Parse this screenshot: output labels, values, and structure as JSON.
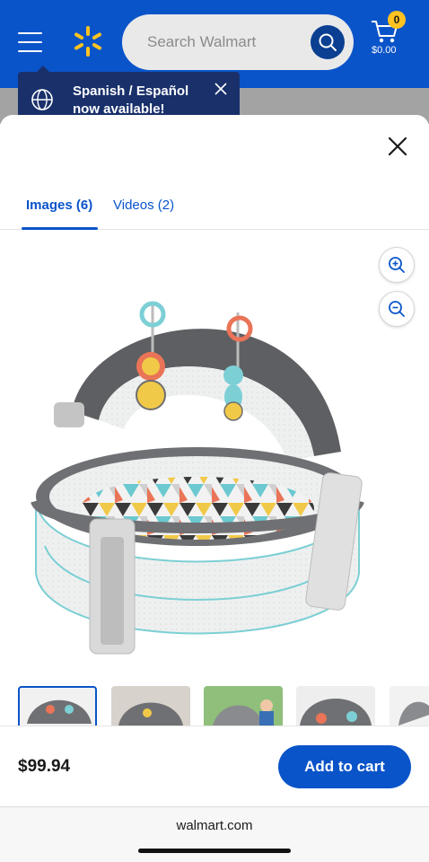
{
  "header": {
    "search_placeholder": "Search Walmart",
    "cart_count": "0",
    "cart_total": "$0.00",
    "brand_color": "#0a54c9",
    "spark_color": "#ffc220"
  },
  "language_tip": {
    "message": "Spanish / Español now available!"
  },
  "modal": {
    "tabs": [
      {
        "label": "Images (6)",
        "active": true
      },
      {
        "label": "Videos (2)",
        "active": false
      }
    ],
    "zoom_in_icon": "zoom-in-icon",
    "zoom_out_icon": "zoom-out-icon",
    "thumbnails_selected_index": 0
  },
  "footer": {
    "price": "$99.94",
    "add_to_cart_label": "Add to cart"
  },
  "browser": {
    "domain": "walmart.com"
  }
}
